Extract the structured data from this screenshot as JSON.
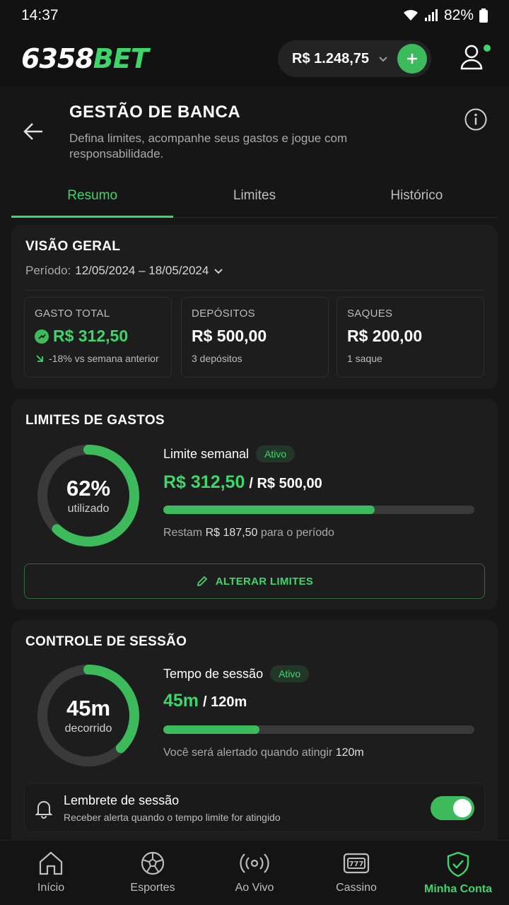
{
  "status": {
    "time": "14:37",
    "battery": "82%"
  },
  "topbar": {
    "logo_part1": "6358",
    "logo_part2": "BET",
    "balance": "R$ 1.248,75"
  },
  "header": {
    "title": "GESTÃO DE BANCA",
    "subtitle": "Defina limites, acompanhe seus gastos e jogue com responsabilidade."
  },
  "tabs": [
    {
      "label": "Resumo",
      "active": true
    },
    {
      "label": "Limites",
      "active": false
    },
    {
      "label": "Histórico",
      "active": false
    }
  ],
  "overview": {
    "title": "VISÃO GERAL",
    "period_label": "Período:",
    "period_value": "12/05/2024 – 18/05/2024",
    "stats": [
      {
        "label": "GASTO TOTAL",
        "value": "R$ 312,50",
        "sub": "-18% vs semana anterior"
      },
      {
        "label": "DEPÓSITOS",
        "value": "R$ 500,00",
        "sub": "3 depósitos"
      },
      {
        "label": "SAQUES",
        "value": "R$ 200,00",
        "sub": "1 saque"
      }
    ]
  },
  "spending": {
    "title": "LIMITES DE GASTOS",
    "ring_value": "62%",
    "ring_label": "utilizado",
    "ring_fraction": 0.62,
    "limit_label": "Limite semanal",
    "status": "Ativo",
    "spent": "R$ 312,50",
    "limit": "/ R$ 500,00",
    "progress_fraction": 0.68,
    "remaining_prefix": "Restam",
    "remaining_value": "R$ 187,50",
    "remaining_suffix": "para o período",
    "button_label": "ALTERAR LIMITES"
  },
  "session": {
    "title": "CONTROLE DE SESSÃO",
    "ring_value": "45m",
    "ring_label": "decorrido",
    "ring_fraction": 0.375,
    "label": "Tempo de sessão",
    "status": "Ativo",
    "elapsed": "45m",
    "limit": "/ 120m",
    "progress_fraction": 0.31,
    "note_prefix": "Você será alertado quando atingir",
    "note_value": "120m",
    "reminder_title": "Lembrete de sessão",
    "reminder_sub": "Receber alerta quando o tempo limite for atingido",
    "reminder_on": true
  },
  "nav": [
    {
      "label": "Início",
      "icon": "home-icon"
    },
    {
      "label": "Esportes",
      "icon": "soccer-ball-icon"
    },
    {
      "label": "Ao Vivo",
      "icon": "live-broadcast-icon"
    },
    {
      "label": "Cassino",
      "icon": "slot-machine-icon"
    },
    {
      "label": "Minha Conta",
      "icon": "shield-check-icon"
    }
  ],
  "colors": {
    "accent": "#3dd66b",
    "accent_dark": "#3dba5c",
    "background": "#121212",
    "card": "#1d1d1d"
  }
}
